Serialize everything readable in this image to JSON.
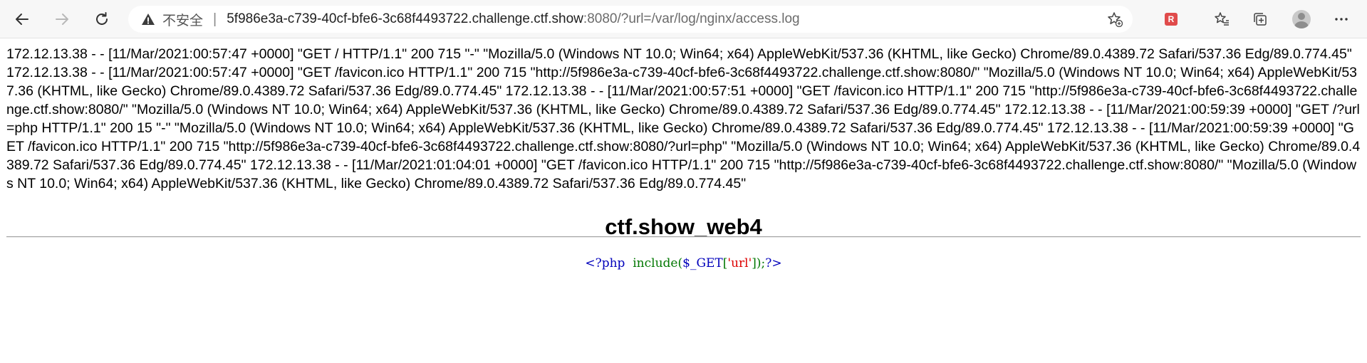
{
  "browser": {
    "security_label": "不安全",
    "separator": "|",
    "url_host": "5f986e3a-c739-40cf-bfe6-3c68f4493722.challenge.ctf.show",
    "url_rest": ":8080/?url=/var/log/nginx/access.log",
    "icons": {
      "back": "back-arrow-icon",
      "forward": "forward-arrow-icon",
      "refresh": "refresh-icon",
      "warning": "warning-triangle-icon",
      "add_favorite": "add-favorite-star-icon",
      "extension": "extension-icon",
      "favorites": "favorites-icon",
      "collections": "collections-icon",
      "profile": "profile-avatar-icon",
      "menu": "more-menu-icon"
    },
    "extension_label": "R"
  },
  "page": {
    "log_content": "172.12.13.38 - - [11/Mar/2021:00:57:47 +0000] \"GET / HTTP/1.1\" 200 715 \"-\" \"Mozilla/5.0 (Windows NT 10.0; Win64; x64) AppleWebKit/537.36 (KHTML, like Gecko) Chrome/89.0.4389.72 Safari/537.36 Edg/89.0.774.45\" 172.12.13.38 - - [11/Mar/2021:00:57:47 +0000] \"GET /favicon.ico HTTP/1.1\" 200 715 \"http://5f986e3a-c739-40cf-bfe6-3c68f4493722.challenge.ctf.show:8080/\" \"Mozilla/5.0 (Windows NT 10.0; Win64; x64) AppleWebKit/537.36 (KHTML, like Gecko) Chrome/89.0.4389.72 Safari/537.36 Edg/89.0.774.45\" 172.12.13.38 - - [11/Mar/2021:00:57:51 +0000] \"GET /favicon.ico HTTP/1.1\" 200 715 \"http://5f986e3a-c739-40cf-bfe6-3c68f4493722.challenge.ctf.show:8080/\" \"Mozilla/5.0 (Windows NT 10.0; Win64; x64) AppleWebKit/537.36 (KHTML, like Gecko) Chrome/89.0.4389.72 Safari/537.36 Edg/89.0.774.45\" 172.12.13.38 - - [11/Mar/2021:00:59:39 +0000] \"GET /?url=php HTTP/1.1\" 200 15 \"-\" \"Mozilla/5.0 (Windows NT 10.0; Win64; x64) AppleWebKit/537.36 (KHTML, like Gecko) Chrome/89.0.4389.72 Safari/537.36 Edg/89.0.774.45\" 172.12.13.38 - - [11/Mar/2021:00:59:39 +0000] \"GET /favicon.ico HTTP/1.1\" 200 715 \"http://5f986e3a-c739-40cf-bfe6-3c68f4493722.challenge.ctf.show:8080/?url=php\" \"Mozilla/5.0 (Windows NT 10.0; Win64; x64) AppleWebKit/537.36 (KHTML, like Gecko) Chrome/89.0.4389.72 Safari/537.36 Edg/89.0.774.45\" 172.12.13.38 - - [11/Mar/2021:01:04:01 +0000] \"GET /favicon.ico HTTP/1.1\" 200 715 \"http://5f986e3a-c739-40cf-bfe6-3c68f4493722.challenge.ctf.show:8080/\" \"Mozilla/5.0 (Windows NT 10.0; Win64; x64) AppleWebKit/537.36 (KHTML, like Gecko) Chrome/89.0.4389.72 Safari/537.36 Edg/89.0.774.45\"",
    "title": "ctf.show_web4",
    "code": {
      "open_tag": "<?php",
      "function": "include(",
      "variable": "$_GET",
      "bracket_open": "[",
      "string": "'url'",
      "bracket_close": "]);",
      "close_tag": "?>"
    }
  },
  "colors": {
    "php_tag": "#0000bb",
    "php_keyword": "#007700",
    "php_string": "#dd0000"
  }
}
